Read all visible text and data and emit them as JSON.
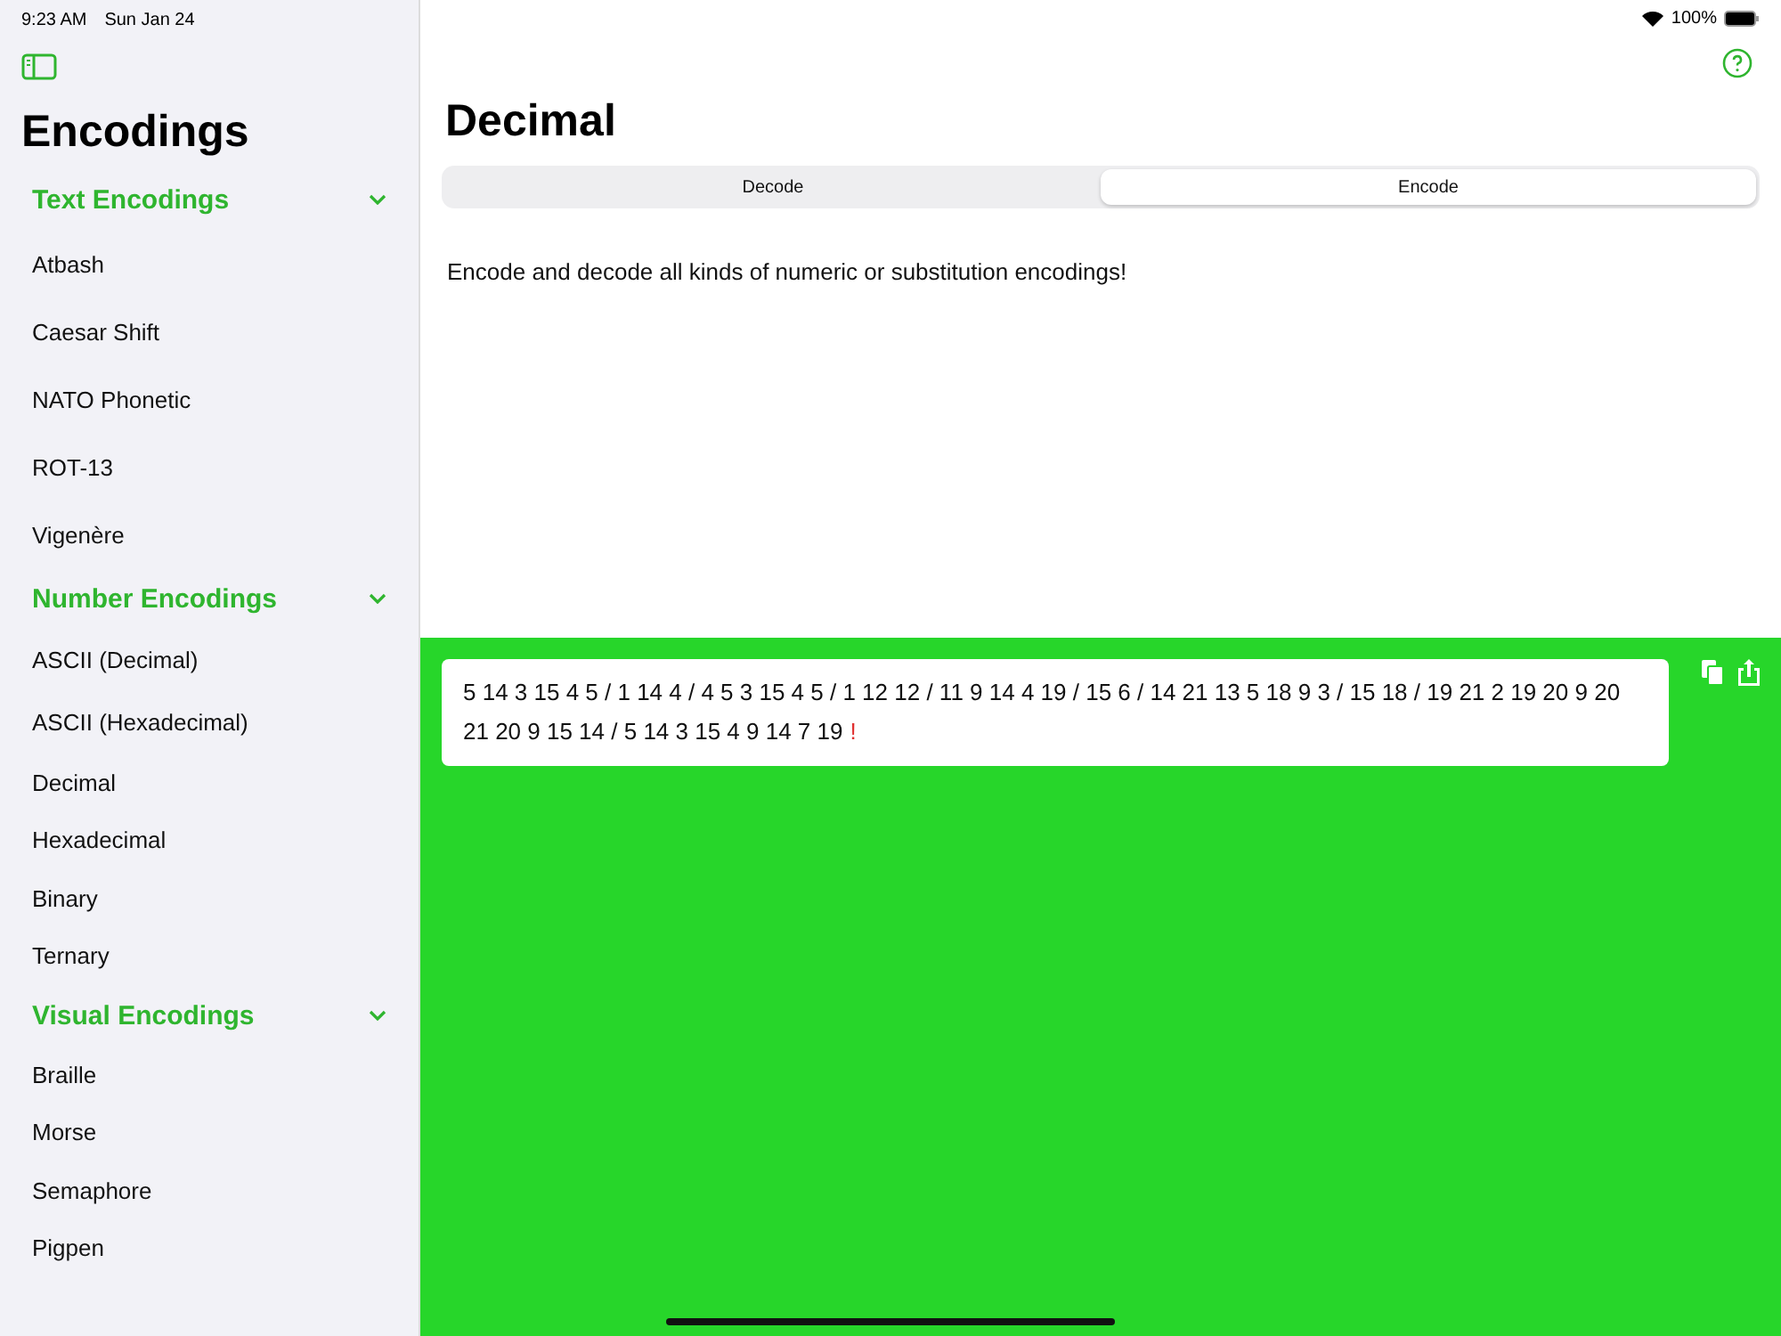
{
  "status_bar": {
    "time": "9:23 AM",
    "date": "Sun Jan 24",
    "battery": "100%"
  },
  "sidebar": {
    "title": "Encodings",
    "sections": [
      {
        "title": "Text Encodings",
        "expanded": true,
        "items": [
          {
            "label": "Atbash",
            "selected": false
          },
          {
            "label": "Caesar Shift",
            "selected": false
          },
          {
            "label": "NATO Phonetic",
            "selected": false
          },
          {
            "label": "ROT-13",
            "selected": false
          },
          {
            "label": "Vigenère",
            "selected": false
          }
        ]
      },
      {
        "title": "Number Encodings",
        "expanded": true,
        "items": [
          {
            "label": "ASCII (Decimal)",
            "selected": false
          },
          {
            "label": "ASCII (Hexadecimal)",
            "selected": false
          },
          {
            "label": "Decimal",
            "selected": false
          },
          {
            "label": "Hexadecimal",
            "selected": false
          },
          {
            "label": "Binary",
            "selected": false
          },
          {
            "label": "Ternary",
            "selected": false
          }
        ]
      },
      {
        "title": "Visual Encodings",
        "expanded": true,
        "items": [
          {
            "label": "Braille",
            "selected": false
          },
          {
            "label": "Morse",
            "selected": false
          },
          {
            "label": "Semaphore",
            "selected": false
          },
          {
            "label": "Pigpen",
            "selected": false
          }
        ]
      }
    ]
  },
  "main": {
    "title": "Decimal",
    "segments": [
      {
        "label": "Decode",
        "selected": false
      },
      {
        "label": "Encode",
        "selected": true
      }
    ],
    "description": "Encode and decode all kinds of numeric or substitution encodings!",
    "output": {
      "value": "5 14 3 15 4 5 / 1 14 4 / 4 5 3 15 4 5 / 1 12 12 / 11 9 14 4 19 / 15 6 / 14 21 13 5 18 9 3 / 15 18 / 19 21 2 19 20 9 20 21 20 9 15 14 / 5 14 3 15 4 9 14 7 19",
      "error_mark": "!"
    }
  }
}
